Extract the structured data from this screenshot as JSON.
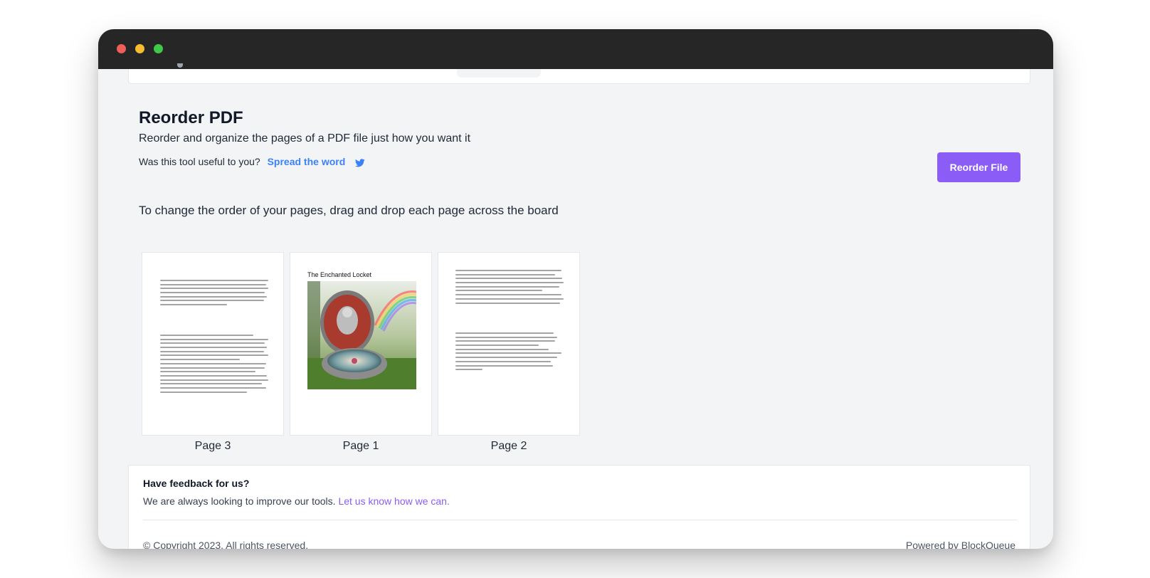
{
  "header": {
    "title": "Reorder PDF",
    "subtitle": "Reorder and organize the pages of a PDF file just how you want it",
    "useful_prompt": "Was this tool useful to you?",
    "share_link": "Spread the word",
    "share_icon": "twitter-icon",
    "action_button": "Reorder File"
  },
  "instructions": "To change the order of your pages, drag and drop each page across the board",
  "pages": [
    {
      "label": "Page 3"
    },
    {
      "label": "Page 1",
      "heading": "The Enchanted Locket"
    },
    {
      "label": "Page 2"
    }
  ],
  "feedback": {
    "title": "Have feedback for us?",
    "text": "We are always looking to improve our tools.",
    "link": "Let us know how we can."
  },
  "footer": {
    "copyright": "© Copyright 2023. All rights reserved.",
    "powered": "Powered by BlockQueue"
  },
  "colors": {
    "accent": "#8b5cf6",
    "link": "#3b82f6",
    "titlebar": "#262626",
    "background": "#f3f4f6"
  }
}
